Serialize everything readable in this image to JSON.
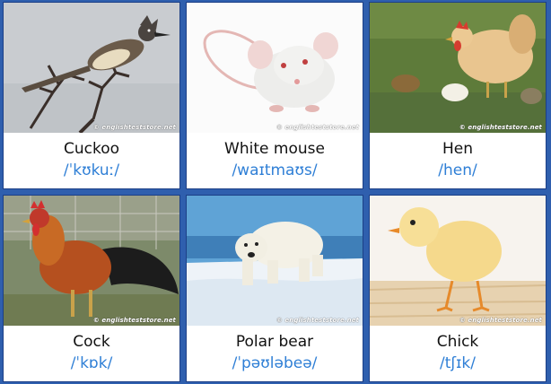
{
  "cards": [
    {
      "name": "Cuckoo",
      "ipa": "/ˈkʊkuː/",
      "watermark": "© englishteststore.net",
      "image": "cuckoo-photo"
    },
    {
      "name": "White mouse",
      "ipa": "/waɪtmaʊs/",
      "watermark": "© englishteststore.net",
      "image": "white-mouse-photo"
    },
    {
      "name": "Hen",
      "ipa": "/hen/",
      "watermark": "© englishteststore.net",
      "image": "hen-photo"
    },
    {
      "name": "Cock",
      "ipa": "/ˈkɒk/",
      "watermark": "© englishteststore.net",
      "image": "cock-photo"
    },
    {
      "name": "Polar bear",
      "ipa": "/ˈpəʊləbeə/",
      "watermark": "© englishteststore.net",
      "image": "polar-bear-photo"
    },
    {
      "name": "Chick",
      "ipa": "/tʃɪk/",
      "watermark": "© englishteststore.net",
      "image": "chick-photo"
    }
  ],
  "colors": {
    "background": "#2f5fae",
    "ipa_text": "#2f7fd6",
    "name_text": "#111111"
  }
}
